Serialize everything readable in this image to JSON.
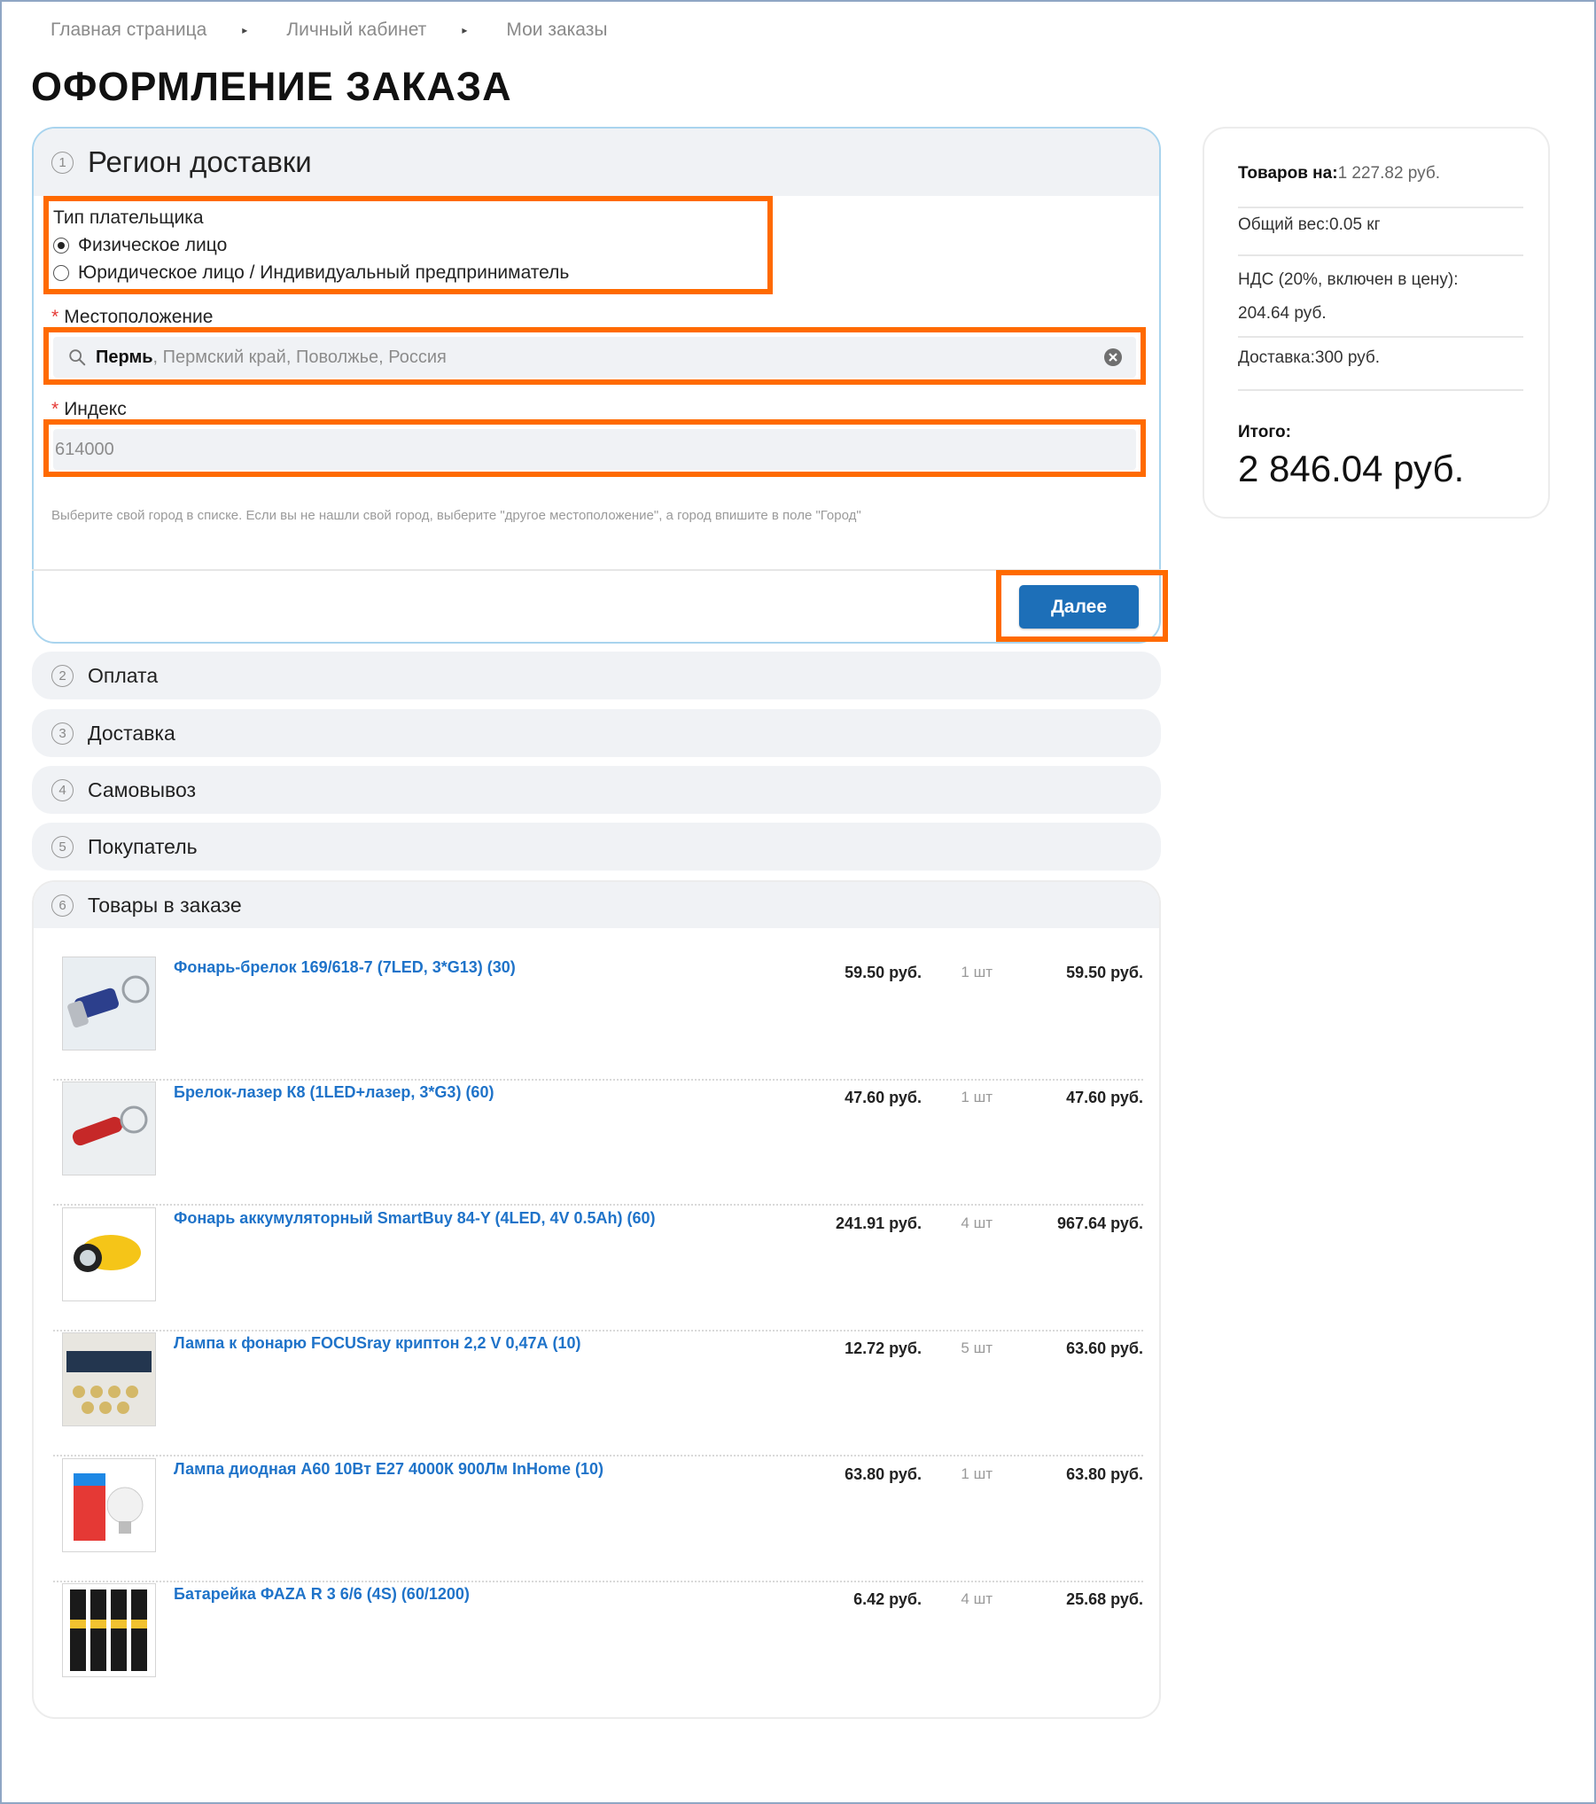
{
  "breadcrumb": [
    "Главная страница",
    "Личный кабинет",
    "Мои заказы"
  ],
  "page_title": "ОФОРМЛЕНИЕ ЗАКАЗА",
  "region": {
    "step": "1",
    "title": "Регион доставки",
    "payer_label": "Тип плательщика",
    "payer_options": [
      "Физическое лицо",
      "Юридическое лицо / Индивидуальный предприниматель"
    ],
    "payer_selected": "Физическое лицо",
    "location_label": "Местоположение",
    "location_query": "Пермь",
    "location_rest": ", Пермский край, Поволжье, Россия",
    "index_label": "Индекс",
    "index_value": "614000",
    "hint": "Выберите свой город в списке. Если вы не нашли свой город, выберите \"другое местоположение\", а город впишите в поле \"Город\"",
    "next_button": "Далее"
  },
  "collapsed_sections": [
    {
      "step": "2",
      "title": "Оплата"
    },
    {
      "step": "3",
      "title": "Доставка"
    },
    {
      "step": "4",
      "title": "Самовывоз"
    },
    {
      "step": "5",
      "title": "Покупатель"
    }
  ],
  "goods": {
    "step": "6",
    "title": "Товары в заказе",
    "items": [
      {
        "name": "Фонарь-брелок 169/618-7 (7LED, 3*G13) (30)",
        "price": "59.50 руб.",
        "qty": "1 шт",
        "sum": "59.50 руб.",
        "image": "keychain-flashlight-image"
      },
      {
        "name": "Брелок-лазер К8 (1LED+лазер, 3*G3) (60)",
        "price": "47.60 руб.",
        "qty": "1 шт",
        "sum": "47.60 руб.",
        "image": "keychain-laser-image"
      },
      {
        "name": "Фонарь аккумуляторный SmartBuy 84-Y (4LED, 4V 0.5Ah) (60)",
        "price": "241.91 руб.",
        "qty": "4 шт",
        "sum": "967.64 руб.",
        "image": "rechargeable-flashlight-image"
      },
      {
        "name": "Лампа к фонарю FOCUSray криптон 2,2 V 0,47А (10)",
        "price": "12.72 руб.",
        "qty": "5 шт",
        "sum": "63.60 руб.",
        "image": "flashlight-bulbs-image"
      },
      {
        "name": "Лампа диодная А60 10Вт Е27 4000К 900Лм InHome (10)",
        "price": "63.80 руб.",
        "qty": "1 шт",
        "sum": "63.80 руб.",
        "image": "led-bulb-image"
      },
      {
        "name": "Батарейка ФАZА R 3 6/6 (4S) (60/1200)",
        "price": "6.42 руб.",
        "qty": "4 шт",
        "sum": "25.68 руб.",
        "image": "batteries-image"
      }
    ]
  },
  "summary": {
    "goods_label": "Товаров на:",
    "goods_value": "1 227.82 руб.",
    "weight_label": "Общий вес:",
    "weight_value": "0.05 кг",
    "vat_label": "НДС (20%, включен в цену):",
    "vat_value": "204.64 руб.",
    "delivery_label": "Доставка:",
    "delivery_value": "300 руб.",
    "total_label": "Итого:",
    "total_value": "2 846.04 руб."
  },
  "colors": {
    "accent": "#1d6fb8",
    "link": "#1f73c9",
    "highlight": "#ff6a00",
    "section_border": "#a9d4ee",
    "header_bg": "#f0f2f5"
  }
}
